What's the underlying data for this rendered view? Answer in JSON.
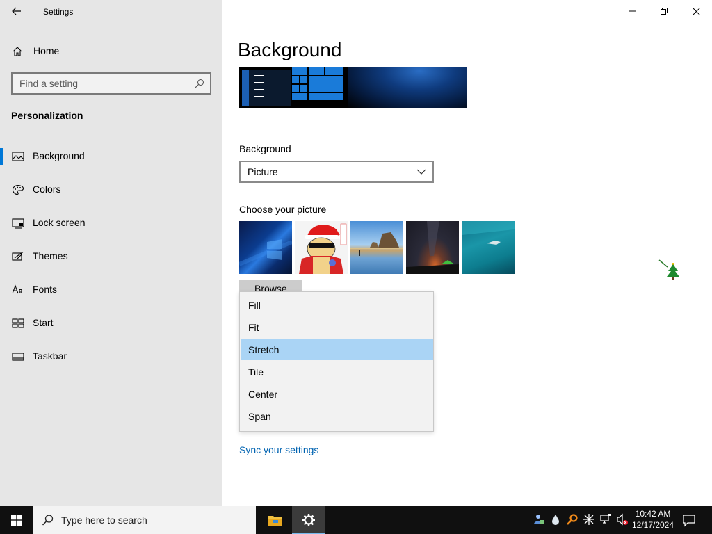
{
  "window": {
    "title": "Settings"
  },
  "sidebar": {
    "home_label": "Home",
    "search_placeholder": "Find a setting",
    "section_title": "Personalization",
    "items": [
      {
        "label": "Background",
        "icon": "picture-icon",
        "active": true
      },
      {
        "label": "Colors",
        "icon": "palette-icon"
      },
      {
        "label": "Lock screen",
        "icon": "lock-screen-icon"
      },
      {
        "label": "Themes",
        "icon": "themes-icon"
      },
      {
        "label": "Fonts",
        "icon": "fonts-icon"
      },
      {
        "label": "Start",
        "icon": "start-icon"
      },
      {
        "label": "Taskbar",
        "icon": "taskbar-icon"
      }
    ]
  },
  "main": {
    "title": "Background",
    "background_label": "Background",
    "background_value": "Picture",
    "choose_picture_label": "Choose your picture",
    "browse_label": "Browse",
    "fit_options": [
      "Fill",
      "Fit",
      "Stretch",
      "Tile",
      "Center",
      "Span"
    ],
    "fit_selected": "Stretch",
    "sync_link": "Sync your settings"
  },
  "taskbar": {
    "search_placeholder": "Type here to search",
    "time": "10:42 AM",
    "date": "12/17/2024"
  },
  "colors": {
    "accent": "#0078d7",
    "selected_option": "#aad4f5",
    "link": "#0063b1",
    "sidebar_bg": "#e6e6e6",
    "taskbar_bg": "#101010"
  }
}
